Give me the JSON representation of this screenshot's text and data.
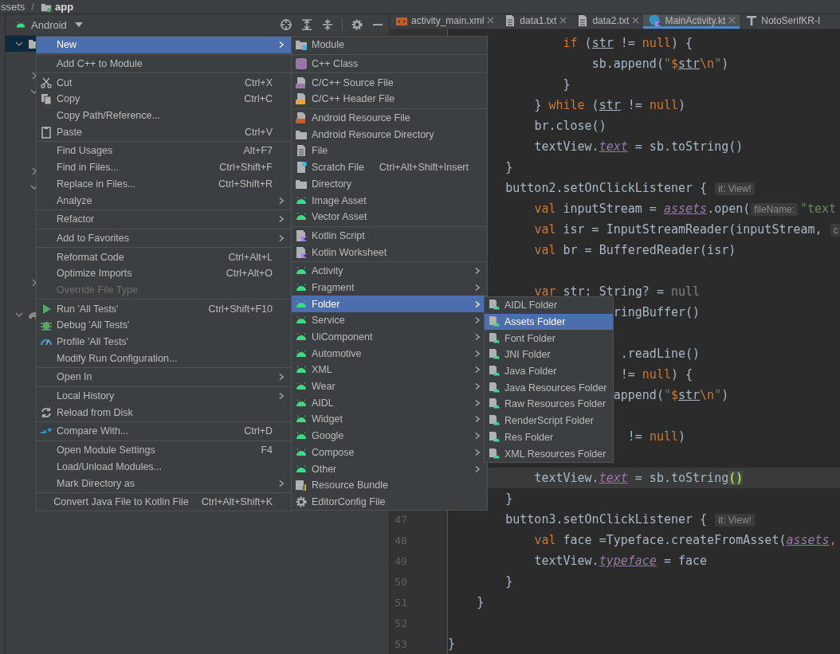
{
  "breadcrumb": {
    "items": [
      "ssets",
      "app"
    ],
    "separator": "/"
  },
  "project_panel": {
    "view": "Android",
    "tree": [
      {
        "kind": "module",
        "expanded": true,
        "selected": true,
        "children": [
          {
            "kind": "covered"
          },
          {
            "kind": "folder",
            "expanded": false,
            "selected": false
          },
          {
            "kind": "folder",
            "expanded": true,
            "selected": false
          },
          {
            "kind": "covered"
          },
          {
            "kind": "covered"
          },
          {
            "kind": "covered"
          },
          {
            "kind": "covered"
          },
          {
            "kind": "folder",
            "expanded": false,
            "selected": false
          },
          {
            "kind": "folder",
            "expanded": true,
            "selected": false
          },
          {
            "kind": "covered"
          },
          {
            "kind": "covered"
          },
          {
            "kind": "covered"
          },
          {
            "kind": "covered"
          },
          {
            "kind": "covered"
          },
          {
            "kind": "folder",
            "expanded": false,
            "selected": false
          },
          {
            "kind": "covered"
          }
        ]
      },
      {
        "kind": "scripts",
        "expanded": true,
        "selected": false
      }
    ]
  },
  "tabs": [
    {
      "label": "activity_main.xml",
      "selected": false
    },
    {
      "label": "data1.txt",
      "selected": false
    },
    {
      "label": "data2.txt",
      "selected": false
    },
    {
      "label": "MainActivity.kt",
      "selected": true
    },
    {
      "label": "NotoSerifKR-I",
      "selected": false
    }
  ],
  "editor": {
    "lines": [
      {
        "current": false,
        "tokens": [
          {
            "kind": "keyword",
            "text": "                if"
          },
          {
            "kind": "plain",
            "text": " ("
          },
          {
            "kind": "var",
            "text": "str"
          },
          {
            "kind": "plain",
            "text": " != "
          },
          {
            "kind": "keyword",
            "text": "null"
          },
          {
            "kind": "plain",
            "text": ") {"
          }
        ]
      },
      {
        "current": false,
        "tokens": [
          {
            "kind": "plain",
            "text": "                    sb.append("
          },
          {
            "kind": "string",
            "text": "\""
          },
          {
            "kind": "keyword",
            "text": "$"
          },
          {
            "kind": "var",
            "text": "str"
          },
          {
            "kind": "keyword",
            "text": "\\n"
          },
          {
            "kind": "string",
            "text": "\""
          },
          {
            "kind": "plain",
            "text": ")"
          }
        ]
      },
      {
        "current": false,
        "tokens": [
          {
            "kind": "plain",
            "text": "                }"
          }
        ]
      },
      {
        "current": false,
        "tokens": [
          {
            "kind": "plain",
            "text": "            } "
          },
          {
            "kind": "keyword",
            "text": "while"
          },
          {
            "kind": "plain",
            "text": " ("
          },
          {
            "kind": "var",
            "text": "str"
          },
          {
            "kind": "plain",
            "text": " != "
          },
          {
            "kind": "keyword",
            "text": "null"
          },
          {
            "kind": "plain",
            "text": ")"
          }
        ]
      },
      {
        "current": false,
        "tokens": [
          {
            "kind": "plain",
            "text": "            br.close()"
          }
        ]
      },
      {
        "current": false,
        "tokens": [
          {
            "kind": "plain",
            "text": "            textView."
          },
          {
            "kind": "property",
            "text": "text"
          },
          {
            "kind": "plain",
            "text": " = sb.toString()"
          }
        ]
      },
      {
        "current": false,
        "tokens": [
          {
            "kind": "plain",
            "text": "        }"
          }
        ]
      },
      {
        "current": false,
        "tokens": [
          {
            "kind": "plain",
            "text": "        button2.setOnClickListener { "
          },
          {
            "kind": "hint",
            "text": "it: View!"
          }
        ]
      },
      {
        "current": false,
        "tokens": [
          {
            "kind": "keyword",
            "text": "            val"
          },
          {
            "kind": "plain",
            "text": " inputStream = "
          },
          {
            "kind": "property",
            "text": "assets"
          },
          {
            "kind": "plain",
            "text": ".open("
          },
          {
            "kind": "hint",
            "text": "fileName:"
          },
          {
            "kind": "string",
            "text": "\"text"
          }
        ]
      },
      {
        "current": false,
        "tokens": [
          {
            "kind": "keyword",
            "text": "            val"
          },
          {
            "kind": "plain",
            "text": " isr = InputStreamReader(inputStream, "
          },
          {
            "kind": "hint",
            "text": "c"
          }
        ]
      },
      {
        "current": false,
        "tokens": [
          {
            "kind": "keyword",
            "text": "            val"
          },
          {
            "kind": "plain",
            "text": " br = BufferedReader(isr)"
          }
        ]
      },
      {
        "current": false
      },
      {
        "current": false,
        "tokens": [
          {
            "kind": "keyword",
            "text": "            var"
          },
          {
            "kind": "plain",
            "text": " str: String? = "
          },
          {
            "kind": "dim",
            "text": "null"
          }
        ]
      },
      {
        "current": false,
        "tokens": [
          {
            "kind": "plain",
            "text": "                       ringBuffer()"
          }
        ]
      },
      {
        "current": false
      },
      {
        "current": false,
        "tokens": [
          {
            "kind": "plain",
            "text": "                        .readLine()"
          }
        ]
      },
      {
        "current": false,
        "tokens": [
          {
            "kind": "plain",
            "text": "                        != "
          },
          {
            "kind": "keyword",
            "text": "null"
          },
          {
            "kind": "plain",
            "text": ") {"
          }
        ]
      },
      {
        "current": false,
        "tokens": [
          {
            "kind": "plain",
            "text": "                       append("
          },
          {
            "kind": "string",
            "text": "\""
          },
          {
            "kind": "keyword",
            "text": "$"
          },
          {
            "kind": "var",
            "text": "str"
          },
          {
            "kind": "keyword",
            "text": "\\n"
          },
          {
            "kind": "string",
            "text": "\""
          },
          {
            "kind": "plain",
            "text": ")"
          }
        ]
      },
      {
        "current": false
      },
      {
        "current": false,
        "tokens": [
          {
            "kind": "plain",
            "text": "                         != "
          },
          {
            "kind": "keyword",
            "text": "null"
          },
          {
            "kind": "plain",
            "text": ")"
          }
        ]
      },
      {
        "current": false
      },
      {
        "current": true,
        "tokens": [
          {
            "kind": "plain",
            "text": "            textView."
          },
          {
            "kind": "property",
            "text": "text"
          },
          {
            "kind": "plain",
            "text": " = sb.toString"
          },
          {
            "kind": "match",
            "text": "()"
          }
        ]
      },
      {
        "current": false,
        "tokens": [
          {
            "kind": "plain",
            "text": "        }"
          }
        ]
      },
      {
        "number": "47",
        "current": false,
        "tokens": [
          {
            "kind": "plain",
            "text": "        button3.setOnClickListener { "
          },
          {
            "kind": "hint",
            "text": "it: View!"
          }
        ]
      },
      {
        "number": "48",
        "current": false,
        "tokens": [
          {
            "kind": "keyword",
            "text": "            val"
          },
          {
            "kind": "plain",
            "text": " face =Typeface.createFromAsset("
          },
          {
            "kind": "property",
            "text": "assets"
          },
          {
            "kind": "keyword",
            "text": ","
          }
        ]
      },
      {
        "number": "49",
        "current": false,
        "tokens": [
          {
            "kind": "plain",
            "text": "            textView."
          },
          {
            "kind": "property",
            "text": "typeface"
          },
          {
            "kind": "plain",
            "text": " = face"
          }
        ]
      },
      {
        "number": "50",
        "current": false,
        "tokens": [
          {
            "kind": "plain",
            "text": "        }"
          }
        ]
      },
      {
        "number": "51",
        "current": false,
        "tokens": [
          {
            "kind": "plain",
            "text": "    }"
          }
        ]
      },
      {
        "number": "52",
        "current": false
      },
      {
        "number": "53",
        "current": false,
        "tokens": [
          {
            "kind": "plain",
            "text": "}"
          }
        ]
      }
    ]
  },
  "context_menu": {
    "groups": [
      {
        "items": [
          {
            "label": "New",
            "submenu": true,
            "selected": true,
            "disabled": false
          }
        ]
      },
      {
        "items": [
          {
            "label": "Add C++ to Module",
            "submenu": false,
            "selected": false,
            "disabled": false
          }
        ]
      },
      {
        "items": [
          {
            "label": "Cut",
            "shortcut": "Ctrl+X",
            "submenu": false,
            "selected": false,
            "disabled": false
          },
          {
            "label": "Copy",
            "shortcut": "Ctrl+C",
            "submenu": false,
            "selected": false,
            "disabled": false
          },
          {
            "label": "Copy Path/Reference...",
            "submenu": false,
            "selected": false,
            "disabled": false
          },
          {
            "label": "Paste",
            "shortcut": "Ctrl+V",
            "submenu": false,
            "selected": false,
            "disabled": false
          }
        ]
      },
      {
        "items": [
          {
            "label": "Find Usages",
            "shortcut": "Alt+F7",
            "submenu": false,
            "selected": false,
            "disabled": false
          },
          {
            "label": "Find in Files...",
            "shortcut": "Ctrl+Shift+F",
            "submenu": false,
            "selected": false,
            "disabled": false
          },
          {
            "label": "Replace in Files...",
            "shortcut": "Ctrl+Shift+R",
            "submenu": false,
            "selected": false,
            "disabled": false
          },
          {
            "label": "Analyze",
            "submenu": true,
            "selected": false,
            "disabled": false
          }
        ]
      },
      {
        "items": [
          {
            "label": "Refactor",
            "submenu": true,
            "selected": false,
            "disabled": false
          }
        ]
      },
      {
        "items": [
          {
            "label": "Add to Favorites",
            "submenu": true,
            "selected": false,
            "disabled": false
          }
        ]
      },
      {
        "items": [
          {
            "label": "Reformat Code",
            "shortcut": "Ctrl+Alt+L",
            "submenu": false,
            "selected": false,
            "disabled": false
          },
          {
            "label": "Optimize Imports",
            "shortcut": "Ctrl+Alt+O",
            "submenu": false,
            "selected": false,
            "disabled": false
          },
          {
            "label": "Override File Type",
            "submenu": false,
            "selected": false,
            "disabled": true
          }
        ]
      },
      {
        "items": [
          {
            "label": "Run 'All Tests'",
            "shortcut": "Ctrl+Shift+F10",
            "submenu": false,
            "selected": false,
            "disabled": false
          },
          {
            "label": "Debug 'All Tests'",
            "submenu": false,
            "selected": false,
            "disabled": false
          },
          {
            "label": "Profile 'All Tests'",
            "submenu": false,
            "selected": false,
            "disabled": false
          },
          {
            "label": "Modify Run Configuration...",
            "submenu": false,
            "selected": false,
            "disabled": false
          }
        ]
      },
      {
        "items": [
          {
            "label": "Open In",
            "submenu": true,
            "selected": false,
            "disabled": false
          }
        ]
      },
      {
        "items": [
          {
            "label": "Local History",
            "submenu": true,
            "selected": false,
            "disabled": false
          },
          {
            "label": "Reload from Disk",
            "submenu": false,
            "selected": false,
            "disabled": false
          }
        ]
      },
      {
        "items": [
          {
            "label": "Compare With...",
            "shortcut": "Ctrl+D",
            "submenu": false,
            "selected": false,
            "disabled": false
          }
        ]
      },
      {
        "items": [
          {
            "label": "Open Module Settings",
            "shortcut": "F4",
            "submenu": false,
            "selected": false,
            "disabled": false
          },
          {
            "label": "Load/Unload Modules...",
            "submenu": false,
            "selected": false,
            "disabled": false
          },
          {
            "label": "Mark Directory as",
            "submenu": true,
            "selected": false,
            "disabled": false
          }
        ]
      },
      {
        "items": [
          {
            "label": "Convert Java File to Kotlin File",
            "shortcut": "Ctrl+Alt+Shift+K",
            "submenu": false,
            "selected": false,
            "disabled": false
          }
        ]
      }
    ]
  },
  "new_submenu": {
    "groups": [
      {
        "items": [
          {
            "label": "Module",
            "submenu": false,
            "selected": false,
            "disabled": false
          }
        ]
      },
      {
        "items": [
          {
            "label": "C++ Class",
            "submenu": false,
            "selected": false,
            "disabled": false
          }
        ]
      },
      {
        "items": [
          {
            "label": "C/C++ Source File",
            "submenu": false,
            "selected": false,
            "disabled": false
          },
          {
            "label": "C/C++ Header File",
            "submenu": false,
            "selected": false,
            "disabled": false
          }
        ]
      },
      {
        "items": [
          {
            "label": "Android Resource File",
            "submenu": false,
            "selected": false,
            "disabled": false
          },
          {
            "label": "Android Resource Directory",
            "submenu": false,
            "selected": false,
            "disabled": false
          },
          {
            "label": "File",
            "submenu": false,
            "selected": false,
            "disabled": false
          },
          {
            "label": "Scratch File",
            "shortcut": "Ctrl+Alt+Shift+Insert",
            "submenu": false,
            "selected": false,
            "disabled": false
          },
          {
            "label": "Directory",
            "submenu": false,
            "selected": false,
            "disabled": false
          },
          {
            "label": "Image Asset",
            "submenu": false,
            "selected": false,
            "disabled": false
          },
          {
            "label": "Vector Asset",
            "submenu": false,
            "selected": false,
            "disabled": false
          }
        ]
      },
      {
        "items": [
          {
            "label": "Kotlin Script",
            "submenu": false,
            "selected": false,
            "disabled": false
          },
          {
            "label": "Kotlin Worksheet",
            "submenu": false,
            "selected": false,
            "disabled": false
          }
        ]
      },
      {
        "items": [
          {
            "label": "Activity",
            "submenu": true,
            "selected": false,
            "disabled": false
          },
          {
            "label": "Fragment",
            "submenu": true,
            "selected": false,
            "disabled": false
          },
          {
            "label": "Folder",
            "submenu": true,
            "selected": true,
            "disabled": false
          },
          {
            "label": "Service",
            "submenu": true,
            "selected": false,
            "disabled": false
          },
          {
            "label": "UiComponent",
            "submenu": true,
            "selected": false,
            "disabled": false
          },
          {
            "label": "Automotive",
            "submenu": true,
            "selected": false,
            "disabled": false
          },
          {
            "label": "XML",
            "submenu": true,
            "selected": false,
            "disabled": false
          },
          {
            "label": "Wear",
            "submenu": true,
            "selected": false,
            "disabled": false
          },
          {
            "label": "AIDL",
            "submenu": true,
            "selected": false,
            "disabled": false
          },
          {
            "label": "Widget",
            "submenu": true,
            "selected": false,
            "disabled": false
          },
          {
            "label": "Google",
            "submenu": true,
            "selected": false,
            "disabled": false
          },
          {
            "label": "Compose",
            "submenu": true,
            "selected": false,
            "disabled": false
          },
          {
            "label": "Other",
            "submenu": true,
            "selected": false,
            "disabled": false
          },
          {
            "label": "Resource Bundle",
            "submenu": false,
            "selected": false,
            "disabled": false
          },
          {
            "label": "EditorConfig File",
            "submenu": false,
            "selected": false,
            "disabled": false
          }
        ]
      }
    ]
  },
  "folder_submenu": {
    "groups": [
      {
        "items": [
          {
            "label": "AIDL Folder",
            "selected": false,
            "disabled": false
          },
          {
            "label": "Assets Folder",
            "selected": true,
            "disabled": false
          },
          {
            "label": "Font Folder",
            "selected": false,
            "disabled": false
          },
          {
            "label": "JNI Folder",
            "selected": false,
            "disabled": false
          },
          {
            "label": "Java Folder",
            "selected": false,
            "disabled": false
          },
          {
            "label": "Java Resources Folder",
            "selected": false,
            "disabled": false
          },
          {
            "label": "Raw Resources Folder",
            "selected": false,
            "disabled": false
          },
          {
            "label": "RenderScript Folder",
            "selected": false,
            "disabled": false
          },
          {
            "label": "Res Folder",
            "selected": false,
            "disabled": false
          },
          {
            "label": "XML Resources Folder",
            "selected": false,
            "disabled": false
          }
        ]
      }
    ]
  }
}
